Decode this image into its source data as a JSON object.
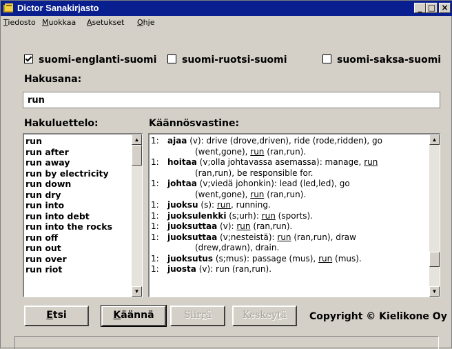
{
  "window": {
    "title": "Dictor Sanakirjasto"
  },
  "menu": [
    {
      "label": "Tiedosto",
      "mnemonic": "T",
      "rest": "iedosto"
    },
    {
      "label": "Muokkaa",
      "mnemonic": "M",
      "rest": "uokkaa"
    },
    {
      "label": "Asetukset",
      "mnemonic": "A",
      "rest": "setukset"
    },
    {
      "label": "Ohje",
      "mnemonic": "O",
      "rest": "hje"
    }
  ],
  "languages": [
    {
      "label": "suomi-englanti-suomi",
      "checked": true
    },
    {
      "label": "suomi-ruotsi-suomi",
      "checked": false
    },
    {
      "label": "suomi-saksa-suomi",
      "checked": false
    }
  ],
  "search": {
    "label": "Hakusana:",
    "value": "run"
  },
  "word_list": {
    "label": "Hakuluettelo:",
    "items": [
      "run",
      "run after",
      "run away",
      "run by electricity",
      "run down",
      "run dry",
      "run into",
      "run into debt",
      "run into the rocks",
      "run off",
      "run out",
      "run over",
      "run riot"
    ]
  },
  "translations": {
    "label": "Käännösvastine:",
    "entries": [
      {
        "num": "1:",
        "head": "ajaa",
        "text": " (v): drive (drove,driven), ride (rode,ridden), go"
      },
      {
        "num": "",
        "cont": "(went,gone), ",
        "ul": "run",
        "after": " (ran,run)."
      },
      {
        "num": "1:",
        "head": "hoitaa",
        "text": " (v;olla johtavassa asemassa): manage, ",
        "ul": "run"
      },
      {
        "num": "",
        "cont": "(ran,run), be responsible for."
      },
      {
        "num": "1:",
        "head": "johtaa",
        "text": " (v;viedä johonkin): lead (led,led), go"
      },
      {
        "num": "",
        "cont": "(went,gone), ",
        "ul": "run",
        "after": " (ran,run)."
      },
      {
        "num": "1:",
        "head": "juoksu",
        "text": " (s): ",
        "ul": "run",
        "after": ", running."
      },
      {
        "num": "1:",
        "head": "juoksulenkki",
        "text": " (s;urh): ",
        "ul": "run",
        "after": " (sports)."
      },
      {
        "num": "1:",
        "head": "juoksuttaa",
        "text": " (v): ",
        "ul": "run",
        "after": " (ran,run)."
      },
      {
        "num": "1:",
        "head": "juoksuttaa",
        "text": " (v;nesteistä): ",
        "ul": "run",
        "after": " (ran,run), draw"
      },
      {
        "num": "",
        "cont": "(drew,drawn), drain."
      },
      {
        "num": "1:",
        "head": "juoksutus",
        "text": " (s;mus): passage (mus), ",
        "ul": "run",
        "after": " (mus)."
      },
      {
        "num": "1:",
        "head": "juosta",
        "text": " (v): run (ran,run)."
      }
    ]
  },
  "buttons": {
    "search": {
      "mnemonic": "E",
      "rest": "tsi",
      "label": "Etsi"
    },
    "translate": {
      "mnemonic": "K",
      "rest": "äännä",
      "label": "Käännä"
    },
    "move": {
      "pre": "Siir",
      "mnemonic": "r",
      "rest": "ä",
      "label": "Siirrä"
    },
    "abort": {
      "pre": "Keskey",
      "mnemonic": "t",
      "rest": "ä",
      "label": "Keskeytä"
    }
  },
  "copyright": "Copyright © Kielikone Oy"
}
